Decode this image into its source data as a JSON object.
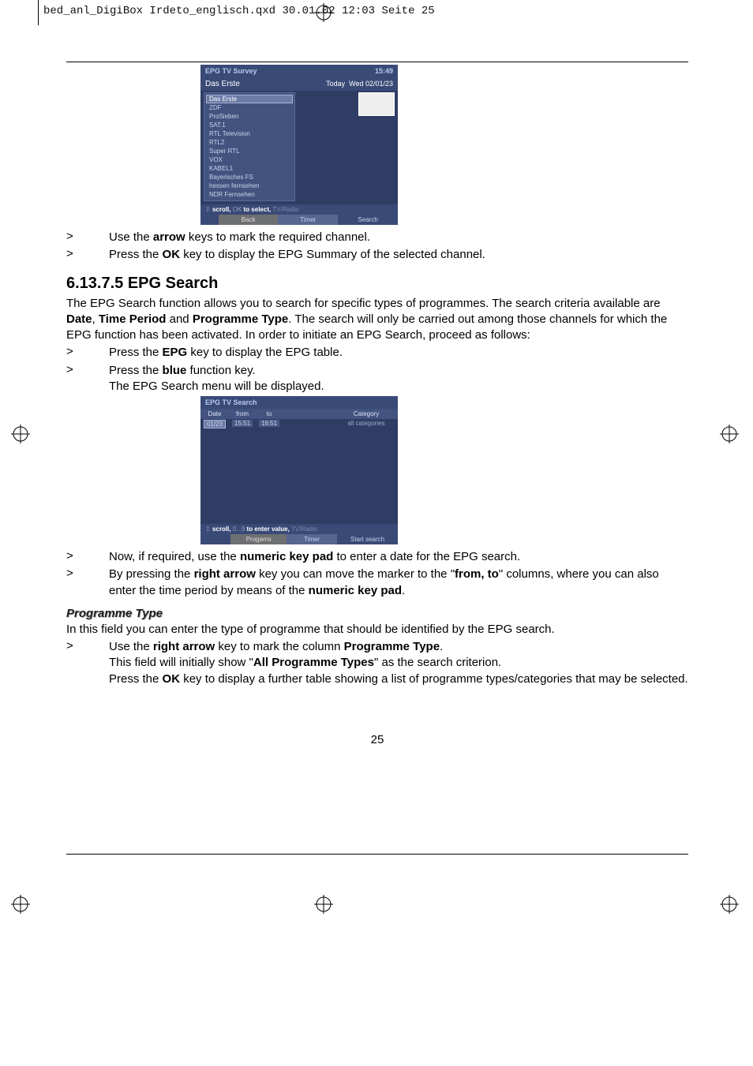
{
  "print_header": "bed_anl_DigiBox Irdeto_englisch.qxd   30.01.02   12:03   Seite 25",
  "epg1": {
    "title": "EPG TV Survey",
    "time": "15:49",
    "channel_name": "Das Erste",
    "today_label": "Today",
    "date_label": "Wed 02/01/23",
    "channels": [
      "Das Erste",
      "ZDF",
      "ProSieben",
      "SAT.1",
      "RTL Television",
      "RTL2",
      "Super RTL",
      "VOX",
      "KABEL1",
      "Bayerisches FS",
      "hessen fernsehen",
      "NDR Fernsehen"
    ],
    "hint_scroll": "scroll,",
    "hint_ok": " OK ",
    "hint_select": "to select,",
    "hint_tv": " TV/Radio",
    "footer": {
      "back": "Back",
      "timer": "Timer",
      "search": "Search"
    }
  },
  "line_arrow": "Use the ",
  "line_arrow_bold": "arrow",
  "line_arrow_rest": " keys to mark the required channel.",
  "line_ok": "Press the ",
  "line_ok_bold": "OK",
  "line_ok_rest": " key to display the EPG Summary of the selected channel.",
  "section_heading": "6.13.7.5 EPG Search",
  "para1_a": "The EPG Search function allows you to search for specific types of programmes. The search criteria available are ",
  "para1_b": "Date",
  "para1_c": ", ",
  "para1_d": "Time Period",
  "para1_e": " and ",
  "para1_f": "Programme Type",
  "para1_g": ". The search will only be carried out among those channels for which the EPG function has been activated. In order to initiate an EPG Search, proceed as follows:",
  "line_epg": "Press the ",
  "line_epg_bold": "EPG",
  "line_epg_rest": " key to display the EPG table.",
  "line_blue": "Press the ",
  "line_blue_bold": "blue",
  "line_blue_rest": " function key.",
  "line_blue2": "The EPG Search menu will be displayed.",
  "epg2": {
    "title": "EPG TV Search",
    "headers": {
      "date": "Date",
      "from": "from",
      "to": "to",
      "category": "Category"
    },
    "values": {
      "date": "01/23",
      "from": "15:51",
      "to": "16:51",
      "category": "all categories"
    },
    "hint_scroll": "scroll,",
    "hint_num": " 0...9 ",
    "hint_enter": "to enter value,",
    "hint_tv": " TV/Radio",
    "footer": {
      "progams": "Progams",
      "timer": "Timer",
      "start": "Start search"
    }
  },
  "line_numpad_a": "Now, if required, use the ",
  "line_numpad_bold": "numeric key pad",
  "line_numpad_b": " to enter a date for the EPG search.",
  "line_right_a": "By pressing the ",
  "line_right_bold1": "right arrow",
  "line_right_b": " key you can move the marker to the \"",
  "line_right_bold2": "from, to",
  "line_right_c": "\" columns, where you can also enter the time period by means of the ",
  "line_right_bold3": "numeric key pad",
  "line_right_d": ".",
  "progtype_heading": "Programme Type",
  "progtype_para": "In this field you can enter the type of programme that should be identified by the EPG search.",
  "pt_line1_a": "Use the ",
  "pt_line1_bold1": "right arrow",
  "pt_line1_b": " key to mark the column ",
  "pt_line1_bold2": "Programme Type",
  "pt_line1_c": ".",
  "pt_line2_a": "This field will initially show \"",
  "pt_line2_bold": "All Programme Types",
  "pt_line2_b": "\" as the search criterion.",
  "pt_line3_a": "Press the ",
  "pt_line3_bold": "OK",
  "pt_line3_b": " key to display a further table showing a list of programme types/categories that may be selected.",
  "page_number": "25"
}
